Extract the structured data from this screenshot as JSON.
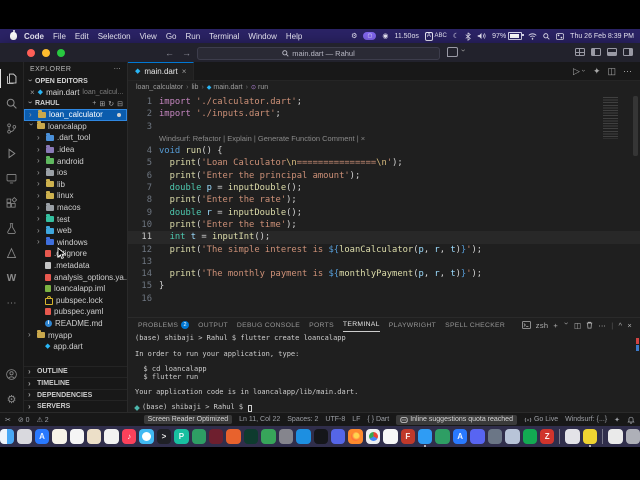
{
  "menu_bar": {
    "items": [
      "Code",
      "File",
      "Edit",
      "Selection",
      "View",
      "Go",
      "Run",
      "Terminal",
      "Window",
      "Help"
    ],
    "status": {
      "metric": "11.50os",
      "input_a": "A",
      "input_abc": "ABC",
      "battery_pct": "97%",
      "clock": "Thu 26 Feb 8:39 PM"
    }
  },
  "title_bar": {
    "title": "main.dart — Rahul",
    "layout_icons": [
      "customize-layout",
      "toggle-primary-sidebar",
      "toggle-panel",
      "toggle-secondary-sidebar"
    ]
  },
  "activity_bar": {
    "top": [
      "explorer",
      "search",
      "source-control",
      "run-debug",
      "remote-explorer",
      "extensions",
      "testing",
      "live-share",
      "windsurf",
      "more"
    ],
    "active": "explorer",
    "bottom": [
      "account",
      "settings"
    ]
  },
  "sidebar": {
    "title": "EXPLORER",
    "more": "⋯",
    "open_editors": {
      "header": "OPEN EDITORS",
      "close": "×",
      "file": "main.dart",
      "hint": "loan_calcul..."
    },
    "workspace": "RAHUL",
    "workspace_actions": [
      "new-file",
      "new-folder",
      "refresh",
      "collapse-all"
    ],
    "tree": [
      {
        "label": "loan_calculator",
        "lvl": 0,
        "ch": "c",
        "icon": "folder",
        "color": "#c9a84c",
        "sel": true,
        "dot": true
      },
      {
        "label": "loancalapp",
        "lvl": 0,
        "ch": "e",
        "icon": "folder",
        "color": "#c9a84c"
      },
      {
        "label": ".dart_tool",
        "lvl": 1,
        "ch": "c",
        "icon": "folder",
        "color": "#4a90d9"
      },
      {
        "label": ".idea",
        "lvl": 1,
        "ch": "c",
        "icon": "folder",
        "color": "#8a7ab8"
      },
      {
        "label": "android",
        "lvl": 1,
        "ch": "c",
        "icon": "folder",
        "color": "#5fb85f"
      },
      {
        "label": "ios",
        "lvl": 1,
        "ch": "c",
        "icon": "folder",
        "color": "#9aa0a6"
      },
      {
        "label": "lib",
        "lvl": 1,
        "ch": "c",
        "icon": "folder",
        "color": "#cdb14e"
      },
      {
        "label": "linux",
        "lvl": 1,
        "ch": "c",
        "icon": "folder",
        "color": "#cdb14e"
      },
      {
        "label": "macos",
        "lvl": 1,
        "ch": "c",
        "icon": "folder",
        "color": "#9aa0a6"
      },
      {
        "label": "test",
        "lvl": 1,
        "ch": "c",
        "icon": "folder",
        "color": "#35c0a0"
      },
      {
        "label": "web",
        "lvl": 1,
        "ch": "c",
        "icon": "folder",
        "color": "#3fa7dd"
      },
      {
        "label": "windows",
        "lvl": 1,
        "ch": "c",
        "icon": "folder",
        "color": "#3f6fdd"
      },
      {
        "label": ".gitignore",
        "lvl": 1,
        "ch": "",
        "icon": "file",
        "color": "#e8594f"
      },
      {
        "label": ".metadata",
        "lvl": 1,
        "ch": "",
        "icon": "file",
        "color": "#c5c5c5"
      },
      {
        "label": "analysis_options.ya...",
        "lvl": 1,
        "ch": "",
        "icon": "file",
        "color": "#e8594f"
      },
      {
        "label": "loancalapp.iml",
        "lvl": 1,
        "ch": "",
        "icon": "file",
        "color": "#7cb342"
      },
      {
        "label": "pubspec.lock",
        "lvl": 1,
        "ch": "",
        "icon": "lock",
        "color": "#d8b62f"
      },
      {
        "label": "pubspec.yaml",
        "lvl": 1,
        "ch": "",
        "icon": "file",
        "color": "#e8594f"
      },
      {
        "label": "README.md",
        "lvl": 1,
        "ch": "",
        "icon": "info",
        "color": "#2f86d2"
      },
      {
        "label": "myapp",
        "lvl": 0,
        "ch": "c",
        "icon": "folder",
        "color": "#c9a84c"
      },
      {
        "label": "app.dart",
        "lvl": 1,
        "ch": "",
        "icon": "dart",
        "color": "#29b6f6"
      }
    ],
    "sections": [
      "OUTLINE",
      "TIMELINE",
      "DEPENDENCIES",
      "SERVERS"
    ]
  },
  "editor": {
    "tab": {
      "label": "main.dart",
      "close": "×"
    },
    "actions": {
      "run": "▷",
      "sparkle": "✦",
      "split": "◫",
      "more": "⋯"
    },
    "breadcrumb": [
      {
        "t": "loan_calculator"
      },
      {
        "t": "lib"
      },
      {
        "t": "main.dart",
        "icon": "dart"
      },
      {
        "t": "run",
        "icon": "method"
      }
    ],
    "lines": [
      {
        "n": "1",
        "tokens": [
          {
            "c": "k",
            "t": "import "
          },
          {
            "c": "s",
            "t": "'./calculator.dart'"
          },
          {
            "c": "p",
            "t": ";"
          }
        ]
      },
      {
        "n": "2",
        "tokens": [
          {
            "c": "k",
            "t": "import "
          },
          {
            "c": "s",
            "t": "'./inputs.dart'"
          },
          {
            "c": "p",
            "t": ";"
          }
        ]
      },
      {
        "n": "3",
        "tokens": []
      },
      {
        "n": "",
        "lens": true,
        "tokens": [
          {
            "c": "lens",
            "t": "Windsurf: Refactor | Explain | Generate Function Comment | ×"
          }
        ]
      },
      {
        "n": "4",
        "tokens": [
          {
            "c": "b",
            "t": "void "
          },
          {
            "c": "f",
            "t": "run"
          },
          {
            "c": "p",
            "t": "() {"
          }
        ]
      },
      {
        "n": "5",
        "tokens": [
          {
            "c": "p",
            "t": "  "
          },
          {
            "c": "f",
            "t": "print"
          },
          {
            "c": "p",
            "t": "("
          },
          {
            "c": "s",
            "t": "'Loan Calculator"
          },
          {
            "c": "e",
            "t": "\\n"
          },
          {
            "c": "s",
            "t": "==============="
          },
          {
            "c": "e",
            "t": "\\n"
          },
          {
            "c": "s",
            "t": "'"
          },
          {
            "c": "p",
            "t": ");"
          }
        ]
      },
      {
        "n": "6",
        "tokens": [
          {
            "c": "p",
            "t": "  "
          },
          {
            "c": "f",
            "t": "print"
          },
          {
            "c": "p",
            "t": "("
          },
          {
            "c": "s",
            "t": "'Enter the principal amount'"
          },
          {
            "c": "p",
            "t": ");"
          }
        ]
      },
      {
        "n": "7",
        "tokens": [
          {
            "c": "p",
            "t": "  "
          },
          {
            "c": "t",
            "t": "double "
          },
          {
            "c": "v",
            "t": "p "
          },
          {
            "c": "p",
            "t": "= "
          },
          {
            "c": "f",
            "t": "inputDouble"
          },
          {
            "c": "p",
            "t": "();"
          }
        ]
      },
      {
        "n": "8",
        "tokens": [
          {
            "c": "p",
            "t": "  "
          },
          {
            "c": "f",
            "t": "print"
          },
          {
            "c": "p",
            "t": "("
          },
          {
            "c": "s",
            "t": "'Enter the rate'"
          },
          {
            "c": "p",
            "t": ");"
          }
        ]
      },
      {
        "n": "9",
        "tokens": [
          {
            "c": "p",
            "t": "  "
          },
          {
            "c": "t",
            "t": "double "
          },
          {
            "c": "v",
            "t": "r "
          },
          {
            "c": "p",
            "t": "= "
          },
          {
            "c": "f",
            "t": "inputDouble"
          },
          {
            "c": "p",
            "t": "();"
          }
        ]
      },
      {
        "n": "10",
        "tokens": [
          {
            "c": "p",
            "t": "  "
          },
          {
            "c": "f",
            "t": "print"
          },
          {
            "c": "p",
            "t": "("
          },
          {
            "c": "s",
            "t": "'Enter the time'"
          },
          {
            "c": "p",
            "t": ");"
          }
        ]
      },
      {
        "n": "11",
        "current": true,
        "tokens": [
          {
            "c": "p",
            "t": "  "
          },
          {
            "c": "t",
            "t": "int "
          },
          {
            "c": "v",
            "t": "t "
          },
          {
            "c": "p",
            "t": "= "
          },
          {
            "c": "f",
            "t": "inputInt"
          },
          {
            "c": "p",
            "t": "();"
          }
        ]
      },
      {
        "n": "12",
        "tokens": [
          {
            "c": "p",
            "t": "  "
          },
          {
            "c": "f",
            "t": "print"
          },
          {
            "c": "p",
            "t": "("
          },
          {
            "c": "s",
            "t": "'The simple interest is "
          },
          {
            "c": "i",
            "t": "${"
          },
          {
            "c": "f",
            "t": "loanCalculator"
          },
          {
            "c": "p",
            "t": "("
          },
          {
            "c": "v",
            "t": "p"
          },
          {
            "c": "p",
            "t": ", "
          },
          {
            "c": "v",
            "t": "r"
          },
          {
            "c": "p",
            "t": ", "
          },
          {
            "c": "v",
            "t": "t"
          },
          {
            "c": "p",
            "t": ")"
          },
          {
            "c": "i",
            "t": "}"
          },
          {
            "c": "s",
            "t": "'"
          },
          {
            "c": "p",
            "t": ");"
          }
        ]
      },
      {
        "n": "13",
        "tokens": []
      },
      {
        "n": "14",
        "tokens": [
          {
            "c": "p",
            "t": "  "
          },
          {
            "c": "f",
            "t": "print"
          },
          {
            "c": "p",
            "t": "("
          },
          {
            "c": "s",
            "t": "'The monthly payment is "
          },
          {
            "c": "i",
            "t": "${"
          },
          {
            "c": "f",
            "t": "monthlyPayment"
          },
          {
            "c": "p",
            "t": "("
          },
          {
            "c": "v",
            "t": "p"
          },
          {
            "c": "p",
            "t": ", "
          },
          {
            "c": "v",
            "t": "r"
          },
          {
            "c": "p",
            "t": ", "
          },
          {
            "c": "v",
            "t": "t"
          },
          {
            "c": "p",
            "t": ")"
          },
          {
            "c": "i",
            "t": "}"
          },
          {
            "c": "s",
            "t": "'"
          },
          {
            "c": "p",
            "t": ");"
          }
        ]
      },
      {
        "n": "15",
        "tokens": [
          {
            "c": "p",
            "t": "}"
          }
        ]
      },
      {
        "n": "16",
        "tokens": []
      }
    ]
  },
  "panel": {
    "tabs": [
      {
        "label": "PROBLEMS",
        "badge": "2"
      },
      {
        "label": "OUTPUT"
      },
      {
        "label": "DEBUG CONSOLE"
      },
      {
        "label": "PORTS"
      },
      {
        "label": "TERMINAL",
        "active": true
      },
      {
        "label": "PLAYWRIGHT"
      },
      {
        "label": "SPELL CHECKER"
      }
    ],
    "shell": "zsh",
    "tab_actions": [
      "new-terminal",
      "launch-profile",
      "split-terminal",
      "kill-terminal",
      "more",
      "maximize-panel",
      "close-panel"
    ],
    "terminal": {
      "lines": [
        {
          "t": "(base) shibaji > Rahul $ flutter create loancalapp"
        },
        {
          "t": ""
        },
        {
          "t": "In order to run your application, type:"
        },
        {
          "t": ""
        },
        {
          "t": "  $ cd loancalapp"
        },
        {
          "t": "  $ flutter run"
        },
        {
          "t": ""
        },
        {
          "t": "Your application code is in loancalapp/lib/main.dart."
        },
        {
          "t": ""
        },
        {
          "t": "(base) shibaji > Rahul $ ",
          "prompt": true
        }
      ]
    }
  },
  "status_bar": {
    "left": [
      {
        "t": "✂",
        "name": "tools-icon"
      },
      {
        "t": "⊘ 0",
        "name": "errors-count"
      },
      {
        "t": "⚠ 2",
        "name": "warnings-count"
      }
    ],
    "right": [
      {
        "t": "Screen Reader Optimized",
        "name": "screen-reader-mode",
        "boxed": true
      },
      {
        "t": "Ln 11, Col 22",
        "name": "cursor-position"
      },
      {
        "t": "Spaces: 2",
        "name": "indentation"
      },
      {
        "t": "UTF-8",
        "name": "encoding"
      },
      {
        "t": "LF",
        "name": "eol-sequence"
      },
      {
        "t": "{ } Dart",
        "name": "language-mode"
      },
      {
        "t": "Inline suggestions quota reached",
        "name": "copilot-quota",
        "boxed": true,
        "icon": "copilot"
      },
      {
        "t": "Go Live",
        "name": "go-live",
        "icon": "broadcast"
      },
      {
        "t": "Windsurf: {...}",
        "name": "windsurf-status"
      },
      {
        "t": "✦",
        "name": "sparkle-icon"
      },
      {
        "t": "",
        "name": "bell-icon",
        "icon": "bell"
      }
    ]
  },
  "dock": {
    "apps": [
      {
        "name": "finder",
        "color": "#49a8f5"
      },
      {
        "name": "calculator",
        "color": "#d9d9de"
      },
      {
        "name": "app-store",
        "color": "#2979ff",
        "glyph": "A"
      },
      {
        "name": "notes",
        "color": "#f7f3e9"
      },
      {
        "name": "calendar",
        "color": "#f5f5f5"
      },
      {
        "name": "contacts",
        "color": "#ecdfc8"
      },
      {
        "name": "photos",
        "color": "#f2f2f2"
      },
      {
        "name": "music",
        "color": "#fb415b",
        "glyph": "♪"
      },
      {
        "name": "safari",
        "color": "#41b9f2"
      },
      {
        "name": "terminal",
        "color": "#1f2026",
        "glyph": ">"
      },
      {
        "name": "pycharm",
        "color": "#18bfa0",
        "glyph": "P"
      },
      {
        "name": "android-studio",
        "color": "#2e9e64"
      },
      {
        "name": "indesign",
        "color": "#6e1f2e"
      },
      {
        "name": "warp",
        "color": "#e8622d"
      },
      {
        "name": "iterm",
        "color": "#0e3b2e"
      },
      {
        "name": "audio-tool",
        "color": "#37a55a"
      },
      {
        "name": "system-settings",
        "color": "#85858d"
      },
      {
        "name": "docker",
        "color": "#1d8fe1"
      },
      {
        "name": "github-desktop",
        "color": "#15161a"
      },
      {
        "name": "gradient-app",
        "color": "#5566e8"
      },
      {
        "name": "firefox",
        "color": "#ff8a2d"
      },
      {
        "name": "chrome",
        "color": "#eef0f2"
      },
      {
        "name": "google-app",
        "color": "#f7f7f7"
      },
      {
        "name": "flutter-tool",
        "color": "#c0392b",
        "glyph": "F"
      },
      {
        "name": "vscode",
        "color": "#2f9cf4",
        "running": true
      },
      {
        "name": "green-app",
        "color": "#2e9e64"
      },
      {
        "name": "appcode",
        "color": "#2979ff",
        "glyph": "A"
      },
      {
        "name": "discord",
        "color": "#5865f2"
      },
      {
        "name": "xcode",
        "color": "#6b7686"
      },
      {
        "name": "postgres",
        "color": "#b8c4d8"
      },
      {
        "name": "mongodb",
        "color": "#13aa52"
      },
      {
        "name": "zerodha",
        "color": "#d0342c",
        "glyph": "Z"
      },
      {
        "name": "downloads-folder",
        "color": "#e3e3e8",
        "sep": true
      },
      {
        "name": "stickies",
        "color": "#f0d432",
        "running": true
      },
      {
        "name": "documents",
        "color": "#eaeaea",
        "sep": true
      },
      {
        "name": "trash",
        "color": "#aeb0b8"
      }
    ]
  }
}
